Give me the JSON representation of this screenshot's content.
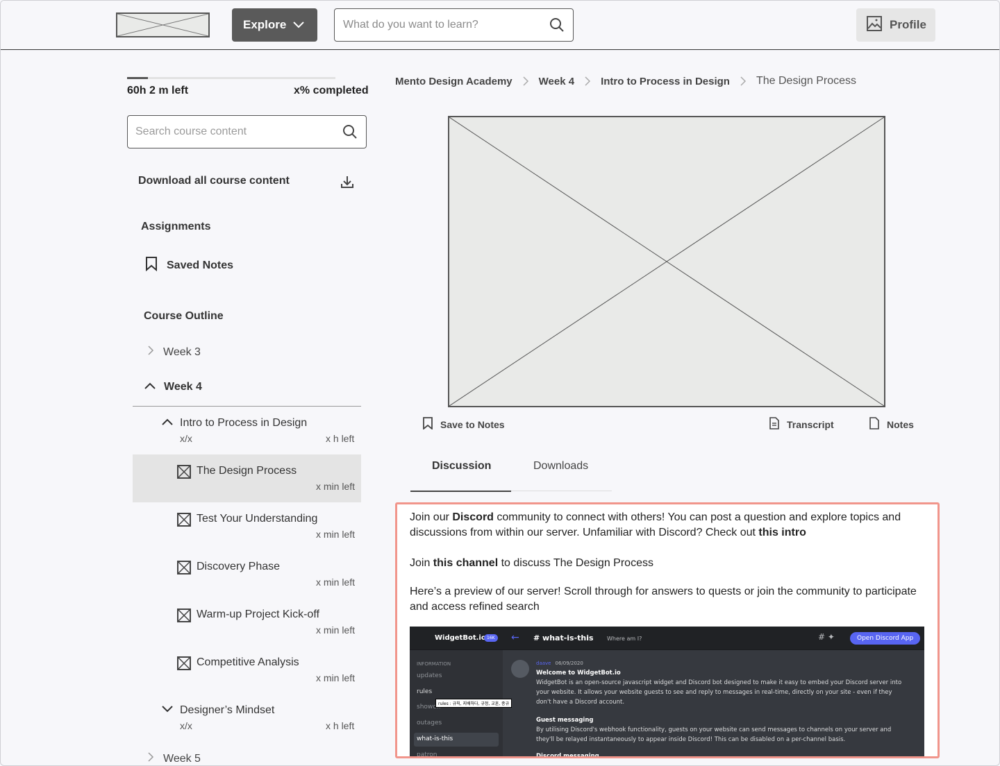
{
  "header": {
    "explore_label": "Explore",
    "search_placeholder": "What do you want to learn?",
    "profile_label": "Profile"
  },
  "sidebar": {
    "progress_fraction": 0.1,
    "time_left": "60h 2 m left",
    "completed": "x% completed",
    "search_placeholder": "Search course content",
    "download_all": "Download all course content",
    "assignments": "Assignments",
    "saved_notes": "Saved Notes",
    "course_outline": "Course Outline",
    "weeks": [
      {
        "label": "Week 3"
      },
      {
        "label": "Week 4"
      },
      {
        "label": "Week 5"
      }
    ],
    "sections": [
      {
        "title": "Intro to Process in Design",
        "progress": "x/x",
        "time": "x h left"
      },
      {
        "title": "Designer’s Mindset",
        "progress": "x/x",
        "time": "x h left"
      }
    ],
    "lessons": [
      {
        "title": "The Design Process",
        "time": "x min left"
      },
      {
        "title": "Test Your Understanding",
        "time": "x min left"
      },
      {
        "title": "Discovery Phase",
        "time": "x min left"
      },
      {
        "title": "Warm-up Project Kick-off",
        "time": "x min left"
      },
      {
        "title": "Competitive Analysis",
        "time": "x min left"
      }
    ]
  },
  "breadcrumb": [
    "Mento Design Academy",
    "Week 4",
    "Intro to Process in Design",
    "The Design Process"
  ],
  "actions": {
    "save_to_notes": "Save to Notes",
    "transcript": "Transcript",
    "notes": "Notes"
  },
  "tabs": [
    "Discussion",
    "Downloads"
  ],
  "discussion": {
    "p1_a": "Join our ",
    "p1_b": "Discord",
    "p1_c": " community to connect with others!  You can post a question and explore topics and discussions from within our server.  Unfamiliar with Discord? Check out ",
    "p1_d": "this intro",
    "p2_a": "Join ",
    "p2_b": "this channel",
    "p2_c": " to discuss The Design Process",
    "p3": "Here’s a preview of our server!  Scroll through for answers to quests or join the community to participate and access refined search"
  },
  "discord": {
    "brand": "WidgetBot.io",
    "badge": "16K",
    "channel": "# what-is-this",
    "where": "Where am I?",
    "open_app": "Open Discord App",
    "category": "INFORMATION",
    "channels": [
      "updates",
      "rules",
      "showoff",
      "outages",
      "what-is-this",
      "patron"
    ],
    "rules_tip": "rules : 규칙, 지배하다, 규정, 교훈, 종규",
    "author": "daave",
    "date": "06/09/2020",
    "welcome": "Welcome to WidgetBot.io",
    "welcome_body": "WidgetBot is an open-source javascript widget and Discord bot designed to make it easy to embed your Discord server into your website. It allows your website guests to see and reply to messages in real-time, directly on your site - even if they don't have a Discord account.",
    "guest_title": "Guest messaging",
    "guest_body": "By utilising Discord's webhook functionality, guests on your website can send messages to channels on your server and they'll be relayed instantaneously to appear inside Discord! This can be disabled on a per-channel basis.",
    "discord_title": "Discord messaging"
  }
}
